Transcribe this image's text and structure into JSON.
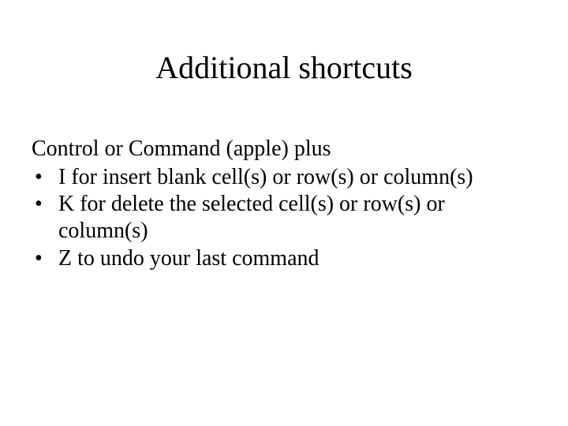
{
  "title": "Additional shortcuts",
  "intro": "Control or Command (apple) plus",
  "bullets": [
    "I for insert blank cell(s) or row(s) or column(s)",
    "K for delete the selected cell(s) or row(s) or column(s)",
    "Z to undo your last command"
  ]
}
